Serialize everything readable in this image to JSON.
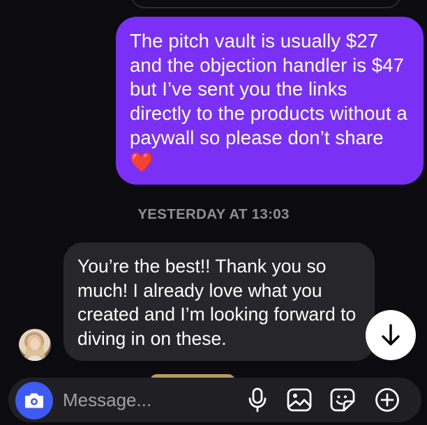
{
  "thread": {
    "sent_message": "The pitch vault is usually $27 and the objection handler is $47 but I’ve sent you the links directly to the products without a paywall so please don’t share ❤️",
    "timestamp": "YESTERDAY AT 13:03",
    "received_message": "You’re the best!! Thank you so much! I already love what you created and I’m looking forward to diving in on these."
  },
  "composer": {
    "placeholder": "Message..."
  },
  "colors": {
    "sent_bubble": "#7a31f5",
    "received_bubble": "#26262b",
    "camera_button": "#3d5af2",
    "background": "#0c0c10"
  },
  "icons": [
    "camera-icon",
    "microphone-icon",
    "gallery-icon",
    "sticker-icon",
    "plus-icon",
    "arrow-down-icon"
  ]
}
